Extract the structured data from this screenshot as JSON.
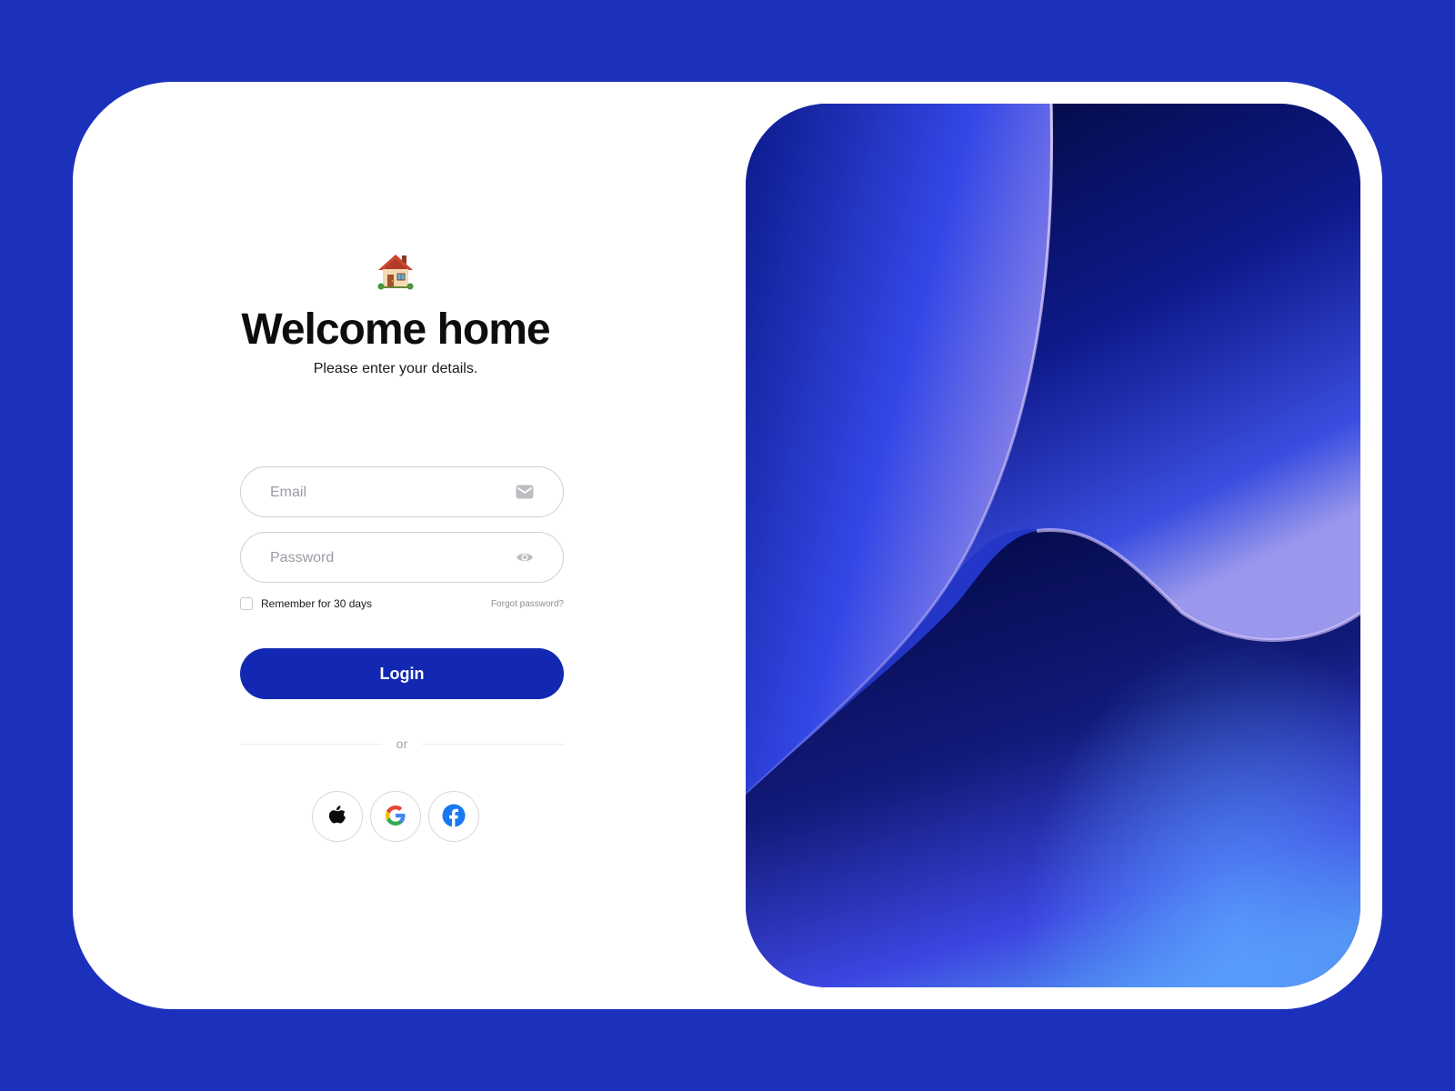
{
  "header": {
    "icon": "house-emoji",
    "title": "Welcome home",
    "subtitle": "Please enter your details."
  },
  "form": {
    "email": {
      "placeholder": "Email",
      "value": "",
      "icon": "mail-icon"
    },
    "password": {
      "placeholder": "Password",
      "value": "",
      "icon": "eye-icon"
    },
    "remember_label": "Remember for 30 days",
    "remember_checked": false,
    "forgot_label": "Forgot password?",
    "login_label": "Login",
    "divider_label": "or"
  },
  "social": [
    {
      "name": "Apple",
      "icon": "apple-icon"
    },
    {
      "name": "Google",
      "icon": "google-icon"
    },
    {
      "name": "Facebook",
      "icon": "facebook-icon"
    }
  ],
  "colors": {
    "page_background": "#1c31bb",
    "card_background": "#ffffff",
    "primary_button": "#1228b3",
    "facebook_blue": "#1877f2"
  }
}
